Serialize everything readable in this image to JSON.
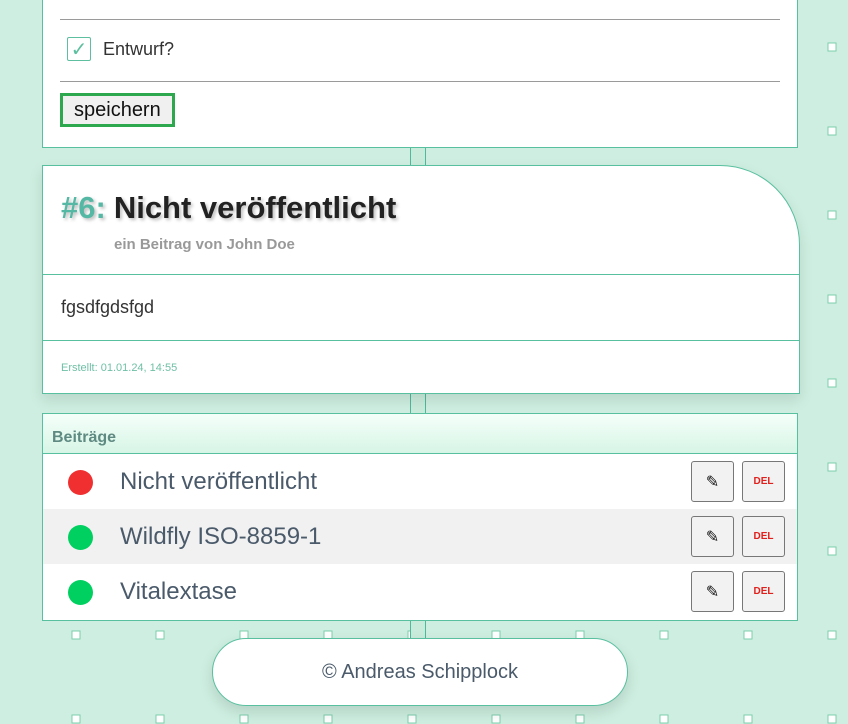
{
  "form": {
    "draft_label": "Entwurf?",
    "draft_checked": true,
    "checkbox_glyph": "✓",
    "save_label": "speichern"
  },
  "post": {
    "number": "#6:",
    "title": "Nicht veröffentlicht",
    "author": "ein Beitrag von John Doe",
    "body": "fgsdfgdsfgd",
    "created": "Erstellt: 01.01.24, 14:55"
  },
  "list": {
    "header": "Beiträge",
    "edit_icon": "pencil-icon",
    "edit_glyph": "✎",
    "del_label": "DEL",
    "items": [
      {
        "title": "Nicht veröffentlicht",
        "status": "unpublished",
        "status_color": "#f03030"
      },
      {
        "title": "Wildfly ISO-8859-1",
        "status": "published",
        "status_color": "#00d060"
      },
      {
        "title": "Vitalextase",
        "status": "published",
        "status_color": "#00d060"
      }
    ]
  },
  "footer": {
    "text": "© Andreas Schipplock"
  },
  "colors": {
    "background": "#cdeee0",
    "accent": "#58c09f",
    "post_number": "#55b8a4",
    "save_border": "#2ea84f",
    "del_text": "#e0201c"
  }
}
